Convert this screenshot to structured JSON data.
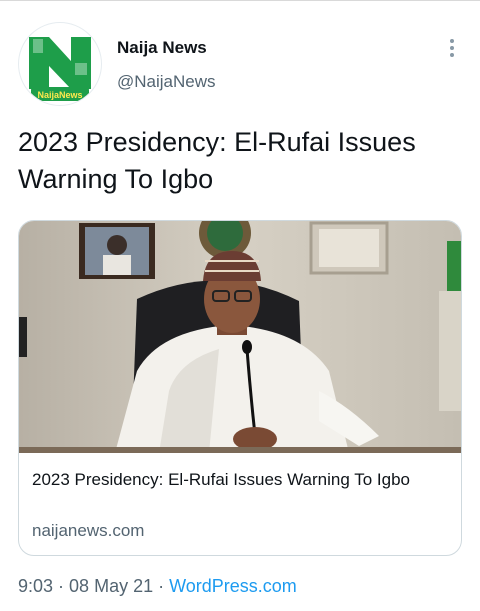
{
  "author": {
    "name": "Naija News",
    "handle": "@NaijaNews",
    "logo_text": "NaijaNews"
  },
  "tweet": {
    "text": "2023 Presidency: El-Rufai Issues Warning To Igbo"
  },
  "card": {
    "title": "2023 Presidency: El-Rufai Issues Warning To Igbo",
    "domain": "naijanews.com"
  },
  "meta": {
    "time": "9:03",
    "separator": " · ",
    "date": "08 May 21",
    "source": "WordPress.com"
  },
  "colors": {
    "brand_green": "#1e9e4a",
    "link_blue": "#1d9bf0",
    "secondary_text": "#536471"
  },
  "icons": {
    "more": "vertical-ellipsis"
  }
}
